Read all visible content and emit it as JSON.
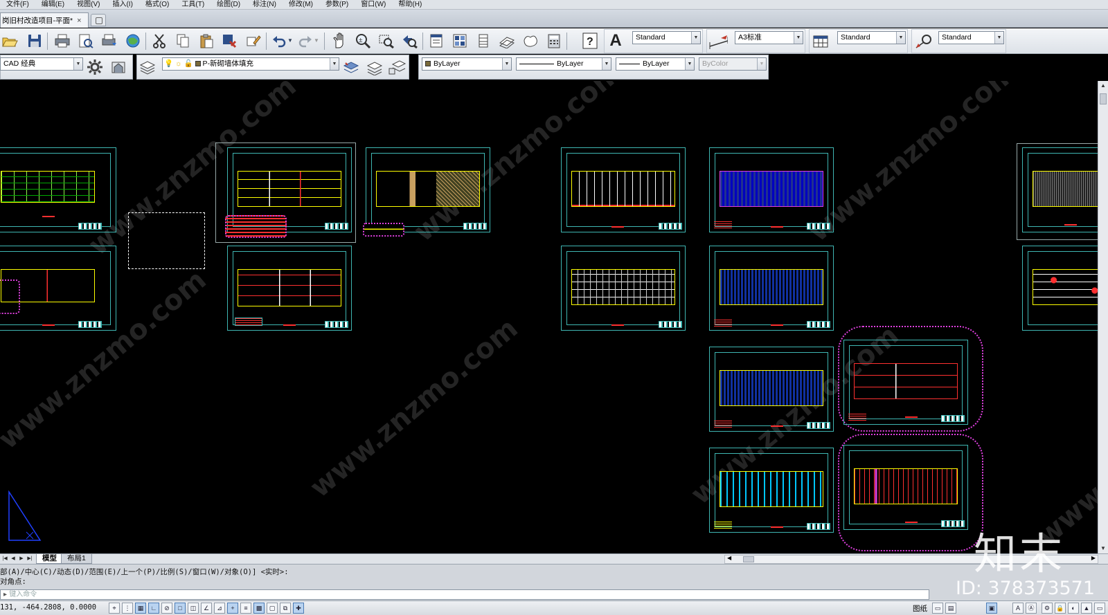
{
  "menu": [
    "文件(F)",
    "编辑(E)",
    "视图(V)",
    "插入(I)",
    "格式(O)",
    "工具(T)",
    "绘图(D)",
    "标注(N)",
    "修改(M)",
    "参数(P)",
    "窗口(W)",
    "帮助(H)"
  ],
  "doc_tab": {
    "title": "岗旧村改造项目-平面*",
    "close": "×"
  },
  "styles": {
    "text_style": "Standard",
    "dim_style": "A3标准",
    "table_style": "Standard",
    "multileader_style": "Standard"
  },
  "workspace": "CAD 经典",
  "layer": "P-新砌墙体填充",
  "properties": {
    "color": "ByLayer",
    "linetype": "ByLayer",
    "lineweight": "ByLayer",
    "plotstyle": "ByColor"
  },
  "layout_tabs": [
    "模型",
    "布局1"
  ],
  "command": {
    "line1": "部(A)/中心(C)/动态(D)/范围(E)/上一个(P)/比例(S)/窗口(W)/对象(O)] <实时>:",
    "line2": "对角点:",
    "placeholder": "键入命令"
  },
  "status": {
    "coords": "131, -464.2808, 0.0000",
    "paper": "图纸"
  },
  "watermark": {
    "site": "www.znzmo.com",
    "brand_cn": "知末网",
    "brand": "知末",
    "id": "ID: 378373571"
  },
  "icons": [
    "new-icon",
    "open-icon",
    "save-icon",
    "print-icon",
    "preview-icon",
    "publish-icon",
    "3d-dwf-icon",
    "cut-icon",
    "copy-icon",
    "paste-icon",
    "match-properties-icon",
    "block-editor-icon",
    "undo-icon",
    "redo-icon",
    "pan-icon",
    "zoom-realtime-icon",
    "zoom-window-icon",
    "zoom-previous-icon",
    "properties-icon",
    "design-center-icon",
    "tool-palettes-icon",
    "sheet-set-icon",
    "markup-icon",
    "quickcalc-icon",
    "help-icon"
  ],
  "colors": {
    "frame": "#3fb7b3",
    "plan": "#ffff00",
    "revision_cloud": "#e040e0",
    "accent_red": "#ff3030",
    "background": "#000000"
  }
}
